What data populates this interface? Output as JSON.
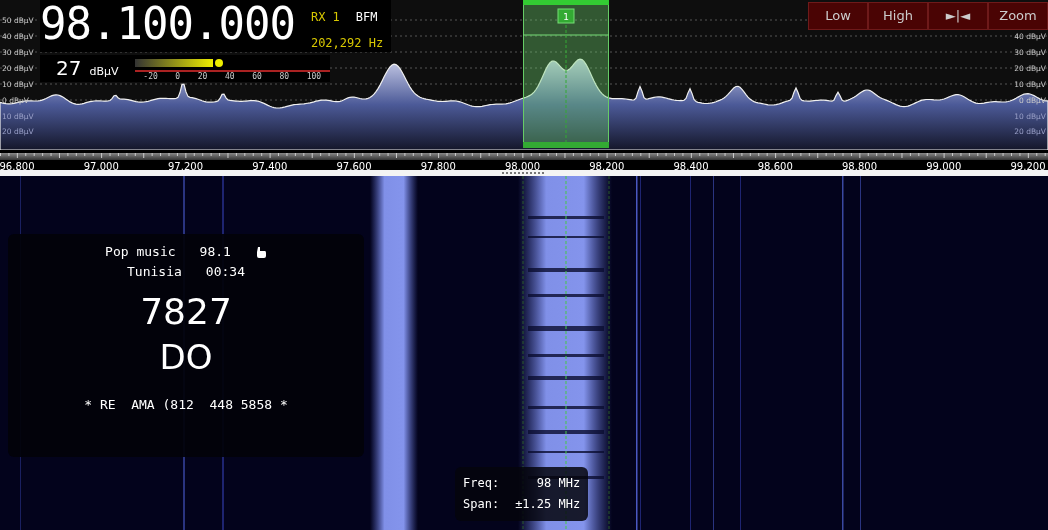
{
  "frequency_display": {
    "frequency": "98.100.000",
    "receiver": "RX 1",
    "mode": "BFM",
    "offset": "202,292 Hz"
  },
  "signal_meter": {
    "value": "27",
    "unit": "dBµV",
    "level": 0.4,
    "scale": [
      "-20",
      "0",
      "20",
      "40",
      "60",
      "80",
      "100"
    ]
  },
  "buttons": [
    {
      "label": "Low"
    },
    {
      "label": "High"
    },
    {
      "label": "►|◄"
    },
    {
      "label": "Zoom"
    }
  ],
  "spectrum": {
    "db_labels_left": [
      "50 dBµV",
      "40 dBµV",
      "30 dBµV",
      "20 dBµV",
      "10 dBµV",
      "0 dBµV",
      "10 dBµV",
      "20 dBµV"
    ],
    "db_labels_right": [
      "40 dBµV",
      "30 dBµV",
      "20 dBµV",
      "10 dBµV",
      "0 dBµV",
      "10 dBµV",
      "20 dBµV"
    ],
    "channel_marker": {
      "label": "1"
    }
  },
  "frequency_axis": {
    "labels": [
      "96.800",
      "97.000",
      "97.200",
      "97.400",
      "97.600",
      "97.800",
      "98.000",
      "98.200",
      "98.400",
      "98.600",
      "98.800",
      "99.000",
      "99.200"
    ]
  },
  "rds_panel": {
    "program_type": "Pop music",
    "frequency": "98.1",
    "country": "Tunisia",
    "time": "00:34",
    "pi_code": "7827",
    "ps_name": "DO",
    "radiotext": "* RE  AMA (812  448 5858 *"
  },
  "tooltip": {
    "rows": [
      {
        "label": "Freq:",
        "value": "98 MHz"
      },
      {
        "label": "Span:",
        "value": "±1.25 MHz"
      }
    ]
  }
}
